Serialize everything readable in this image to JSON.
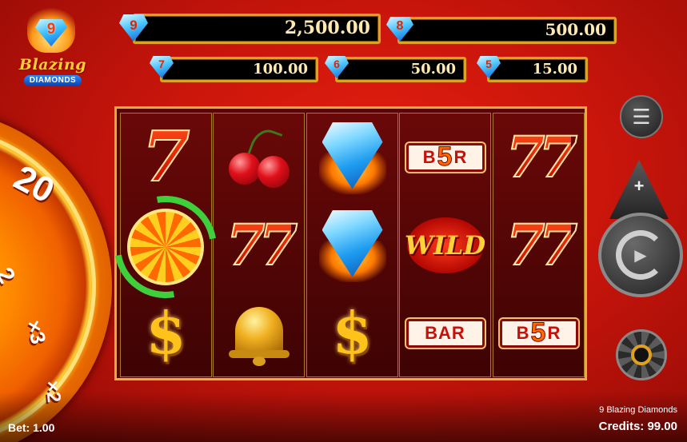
{
  "logo": {
    "gem_number": "9",
    "title": "Blazing",
    "subtitle": "DIAMONDS"
  },
  "jackpots": [
    {
      "tier": "9",
      "value": "2,500.00"
    },
    {
      "tier": "8",
      "value": "500.00"
    },
    {
      "tier": "7",
      "value": "100.00"
    },
    {
      "tier": "6",
      "value": "50.00"
    },
    {
      "tier": "5",
      "value": "15.00"
    }
  ],
  "wheel": {
    "labels": [
      "20",
      "2",
      "×3",
      "×2"
    ]
  },
  "reels": [
    [
      "7",
      "bonus-wheel",
      "$"
    ],
    [
      "cherry",
      "77",
      "bell"
    ],
    [
      "diamond",
      "diamond",
      "$"
    ],
    [
      "BAR-5",
      "WILD",
      "BAR"
    ],
    [
      "77",
      "77",
      "BAR-5"
    ]
  ],
  "symbols": {
    "seven": "7",
    "double_seven": "77",
    "dollar": "$",
    "bar": "BAR",
    "bar_five": "5",
    "wild": "WILD"
  },
  "controls": {
    "menu_icon": "☰",
    "plus_icon": "+",
    "spin_icon": "▶"
  },
  "status": {
    "bet": "Bet: 1.00",
    "game_name": "9 Blazing Diamonds",
    "credits": "Credits: 99.00"
  },
  "colors": {
    "background": "#c8150b",
    "frame": "#e4b03a",
    "jackpot_border": "#e0a020"
  }
}
